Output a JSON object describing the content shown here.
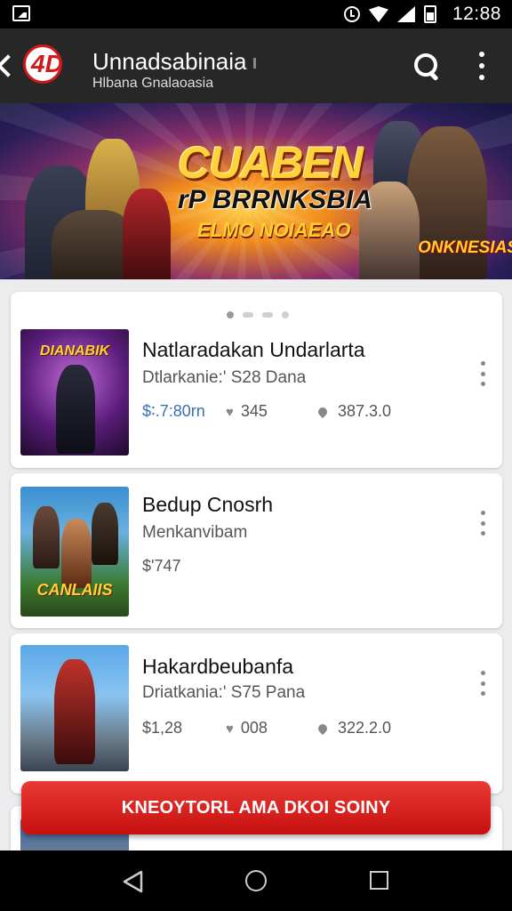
{
  "status_bar": {
    "time": "12:88"
  },
  "app_bar": {
    "title": "Unnadsabinaia",
    "subtitle": "Hlbana Gnalaoasia",
    "logo_text": "4D"
  },
  "banner": {
    "line1": "CUABEN",
    "line2": "rP BRRNKSBIA",
    "line3": "ELMO NOIAEAO",
    "logo": "ONKNESIAS"
  },
  "items": [
    {
      "thumb_label": "DIANABIK",
      "title": "Natlaradakan Undarlarta",
      "subtitle": "Dtlarkanie:' S28 Dana",
      "price": "$∶.7:80rn",
      "likes": "345",
      "rating": "387.3.0"
    },
    {
      "thumb_label": "CANLAIIS",
      "title": "Bedup Cnosrh",
      "subtitle": "Menkanvibam",
      "price": "$'747"
    },
    {
      "title": "Hakardbeubanfa",
      "subtitle": "Driatkania:' S75 Pana",
      "price": "$1,28",
      "likes": "008",
      "rating": "322.2.0"
    }
  ],
  "cta": {
    "label": "KNEOYTORL AMA DKOI SOINY"
  },
  "colors": {
    "brand_red": "#d0191b",
    "app_bar": "#272727"
  }
}
